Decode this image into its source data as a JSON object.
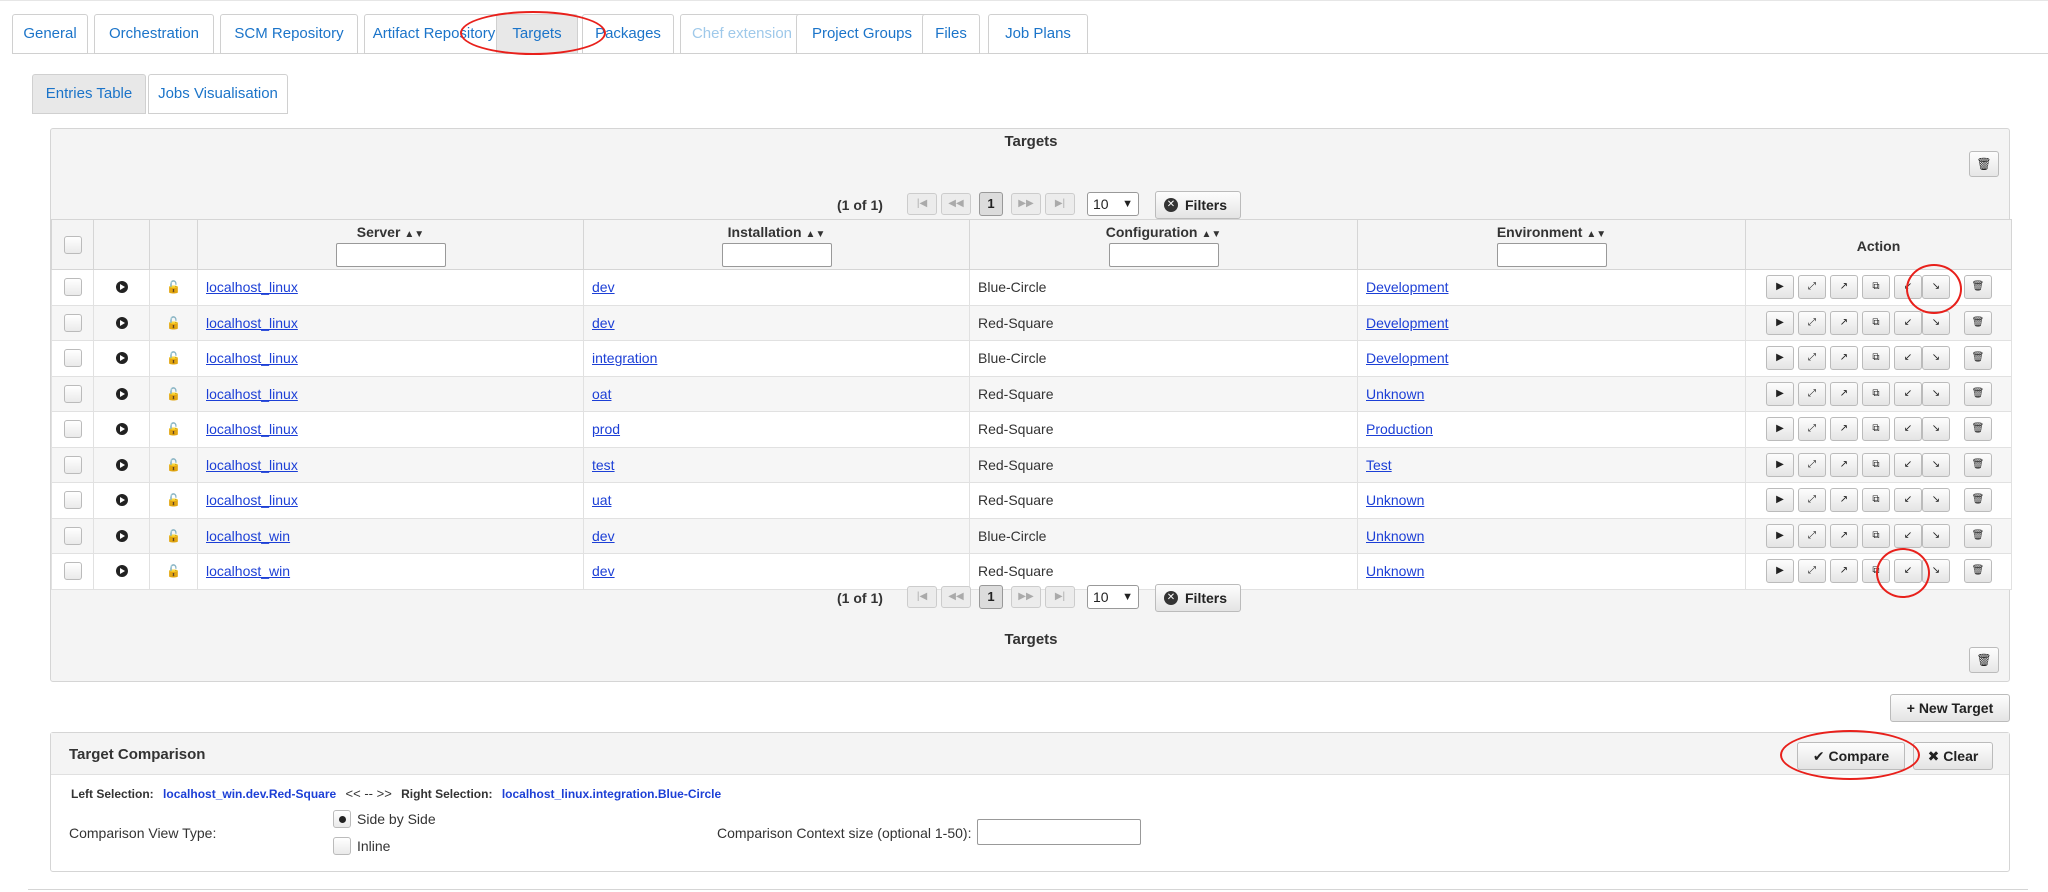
{
  "main_tabs": [
    {
      "label": "General",
      "state": "normal"
    },
    {
      "label": "Orchestration",
      "state": "normal"
    },
    {
      "label": "SCM Repository",
      "state": "normal"
    },
    {
      "label": "Artifact Repository",
      "state": "normal"
    },
    {
      "label": "Targets",
      "state": "active"
    },
    {
      "label": "Packages",
      "state": "normal"
    },
    {
      "label": "Chef extension",
      "state": "disabled"
    },
    {
      "label": "Project Groups",
      "state": "normal"
    },
    {
      "label": "Files",
      "state": "normal"
    },
    {
      "label": "Job Plans",
      "state": "normal"
    }
  ],
  "sub_tabs": [
    {
      "label": "Entries Table",
      "state": "active"
    },
    {
      "label": "Jobs Visualisation",
      "state": "normal"
    }
  ],
  "targets_panel": {
    "title": "Targets",
    "footer_title": "Targets",
    "paginator": {
      "page_info": "(1 of 1)",
      "current_page": "1",
      "rows_per_page": "10",
      "filters_label": "Filters"
    },
    "columns": {
      "server": "Server",
      "installation": "Installation",
      "configuration": "Configuration",
      "environment": "Environment",
      "action": "Action"
    },
    "rows": [
      {
        "server": "localhost_linux",
        "installation": "dev",
        "configuration": "Blue-Circle",
        "environment": "Development"
      },
      {
        "server": "localhost_linux",
        "installation": "dev",
        "configuration": "Red-Square",
        "environment": "Development"
      },
      {
        "server": "localhost_linux",
        "installation": "integration",
        "configuration": "Blue-Circle",
        "environment": "Development"
      },
      {
        "server": "localhost_linux",
        "installation": "oat",
        "configuration": "Red-Square",
        "environment": "Unknown"
      },
      {
        "server": "localhost_linux",
        "installation": "prod",
        "configuration": "Red-Square",
        "environment": "Production"
      },
      {
        "server": "localhost_linux",
        "installation": "test",
        "configuration": "Red-Square",
        "environment": "Test"
      },
      {
        "server": "localhost_linux",
        "installation": "uat",
        "configuration": "Red-Square",
        "environment": "Unknown"
      },
      {
        "server": "localhost_win",
        "installation": "dev",
        "configuration": "Blue-Circle",
        "environment": "Unknown"
      },
      {
        "server": "localhost_win",
        "installation": "dev",
        "configuration": "Red-Square",
        "environment": "Unknown"
      }
    ]
  },
  "new_target_label": "+ New Target",
  "comparison": {
    "title": "Target Comparison",
    "compare_label": "Compare",
    "clear_label": "Clear",
    "left_label": "Left Selection:",
    "left_value": "localhost_win.dev.Red-Square",
    "separator": "<< -- >>",
    "right_label": "Right Selection:",
    "right_value": "localhost_linux.integration.Blue-Circle",
    "view_type_label": "Comparison View Type:",
    "side_by_side_label": "Side by Side",
    "inline_label": "Inline",
    "context_label": "Comparison Context size (optional 1-50):",
    "selected_view_type": "Side by Side"
  },
  "colors": {
    "link": "#1c3fd6",
    "tab_text": "#1b74c9",
    "annotation": "#e8201b"
  }
}
